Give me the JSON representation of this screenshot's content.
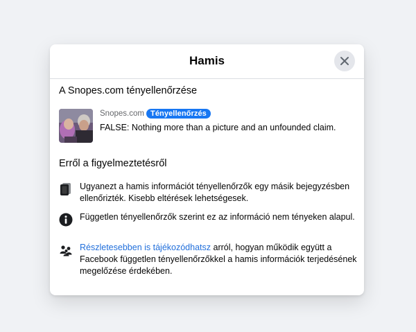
{
  "dialog": {
    "title": "Hamis",
    "close_icon": "close-icon"
  },
  "fact_check": {
    "section_title": "A Snopes.com tényellenőrzése",
    "source": "Snopes.com",
    "badge": "Tényellenőrzés",
    "claim": "FALSE: Nothing more than a picture and an unfounded claim."
  },
  "about": {
    "section_title": "Erről a figyelmeztetésről",
    "items": [
      {
        "icon": "stacked-posts-icon",
        "text": "Ugyanezt a hamis információt tényellenőrzők egy másik bejegyzésben ellenőrizték. Kisebb eltérések lehetségesek."
      },
      {
        "icon": "info-icon",
        "text": "Független tényellenőrzők szerint ez az információ nem tényeken alapul."
      },
      {
        "icon": "people-icon",
        "link_text": "Részletesebben is tájékozódhatsz",
        "text": " arról, hogyan működik együtt a Facebook független tényellenőrzőkkel a hamis információk terjedésének megelőzése érdekében."
      }
    ]
  },
  "colors": {
    "accent": "#1877f2",
    "link": "#216fdb",
    "background": "#f0f2f5"
  }
}
